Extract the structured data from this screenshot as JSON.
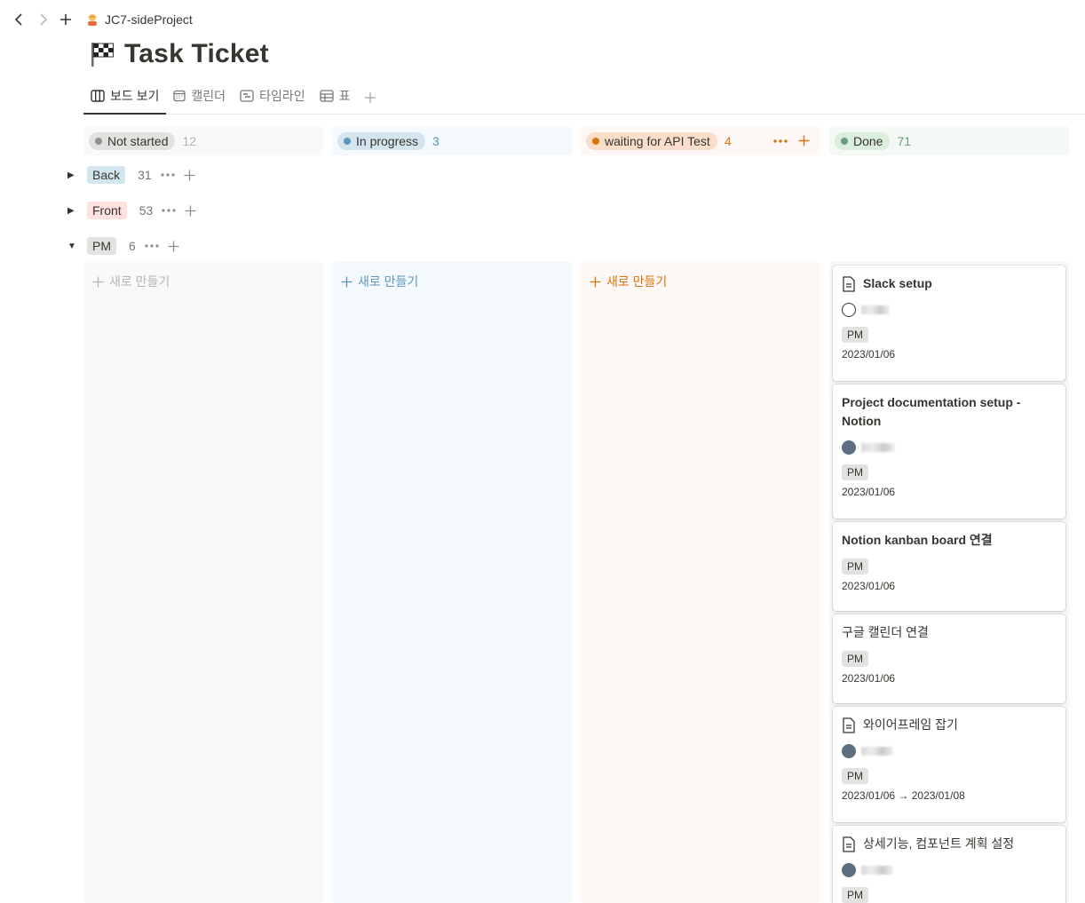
{
  "breadcrumb": {
    "workspace": "JC7-sideProject"
  },
  "page": {
    "title": "Task Ticket"
  },
  "tabs": [
    {
      "label": "보드 보기",
      "icon": "board-icon",
      "active": true
    },
    {
      "label": "캘린더",
      "icon": "calendar-icon",
      "active": false
    },
    {
      "label": "타임라인",
      "icon": "timeline-icon",
      "active": false
    },
    {
      "label": "표",
      "icon": "table-icon",
      "active": false
    }
  ],
  "columns": [
    {
      "label": "Not started",
      "count": "12",
      "color": "#91918e",
      "bg": "#f9f9f8",
      "pill_bg": "#e3e2e0",
      "count_color": "#b4b4b0"
    },
    {
      "label": "In progress",
      "count": "3",
      "color": "#5b97bd",
      "bg": "#f3f9fc",
      "pill_bg": "#d3e5ef",
      "count_color": "#5b97bd"
    },
    {
      "label": "waiting for API Test",
      "count": "4",
      "color": "#d9730d",
      "bg": "#fdf8f5",
      "pill_bg": "#fadec9",
      "count_color": "#d9730d"
    },
    {
      "label": "Done",
      "count": "71",
      "color": "#6c9b7d",
      "bg": "#f4f9f6",
      "pill_bg": "#dbeddb",
      "count_color": "#6c9b7d"
    }
  ],
  "groups": [
    {
      "label": "Back",
      "count": "31",
      "expanded": false,
      "tag_bg": "#d3e5ef"
    },
    {
      "label": "Front",
      "count": "53",
      "expanded": false,
      "tag_bg": "#ffe2dd"
    },
    {
      "label": "PM",
      "count": "6",
      "expanded": true,
      "tag_bg": "#e3e2e0"
    }
  ],
  "lanes": {
    "new_label": "새로 만들기"
  },
  "cards": [
    {
      "title": "Slack setup",
      "has_doc_icon": true,
      "bold": true,
      "has_person": true,
      "tag": "PM",
      "date": "2023/01/06"
    },
    {
      "title": "Project documentation setup - Notion",
      "has_doc_icon": false,
      "bold": true,
      "has_person": true,
      "tag": "PM",
      "date": "2023/01/06"
    },
    {
      "title": "Notion kanban board 연결",
      "has_doc_icon": false,
      "bold": true,
      "has_person": false,
      "tag": "PM",
      "date": "2023/01/06"
    },
    {
      "title": "구글 캘린더 연결",
      "has_doc_icon": false,
      "bold": false,
      "has_person": false,
      "tag": "PM",
      "date": "2023/01/06"
    },
    {
      "title": "와이어프레임 잡기",
      "has_doc_icon": true,
      "bold": false,
      "has_person": true,
      "tag": "PM",
      "date": "2023/01/06 → 2023/01/08"
    },
    {
      "title": "상세기능, 컴포넌트 계획 설정",
      "has_doc_icon": true,
      "bold": false,
      "has_person": true,
      "tag": "PM",
      "date": ""
    }
  ]
}
